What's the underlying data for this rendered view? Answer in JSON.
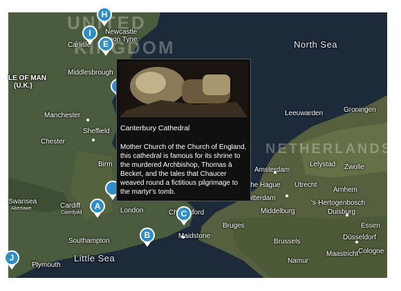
{
  "map": {
    "regions": [
      "UNITED",
      "KINGDOM",
      "NETHERLANDS"
    ],
    "seas": [
      "North Sea",
      "Little Sea"
    ],
    "cities": [
      "Newcastle",
      "upon Tyne",
      "Carlisle",
      "Middlesbrough",
      "LE OF MAN",
      "(U.K.)",
      "Manchester",
      "Sheffield",
      "Chester",
      "Birm",
      "Swansea",
      "Abertawe",
      "Cardiff",
      "Caerdydd",
      "London",
      "Chelmsford",
      "Southampton",
      "Maidstone",
      "Plymouth",
      "Leeuwarden",
      "Groningen",
      "Amsterdam",
      "Lelystad",
      "Zwolle",
      "The Hague",
      "Utrecht",
      "Arnhem",
      "Rotterdam",
      "'s-Hertogenbosch",
      "Bruges",
      "Middelburg",
      "Duisburg",
      "Essen",
      "Brussels",
      "Düsseldorf",
      "Cologne",
      "Namur",
      "Maastricht"
    ],
    "pins": [
      "H",
      "I",
      "E",
      "A",
      "C",
      "B",
      "J"
    ]
  },
  "popup": {
    "title": "Canterbury Cathedral",
    "description": "Mother Church of the Church of England, this cathedral is famous for its shrine to the murdered Archbishop, Thomas à Becket, and the tales that Chaucer weaved round a fictitious pilgrimage to the martyr's tomb."
  },
  "colors": {
    "pin": "#2e8fc8",
    "sea": "#1c2a3a",
    "land": "#4a5a3c"
  }
}
